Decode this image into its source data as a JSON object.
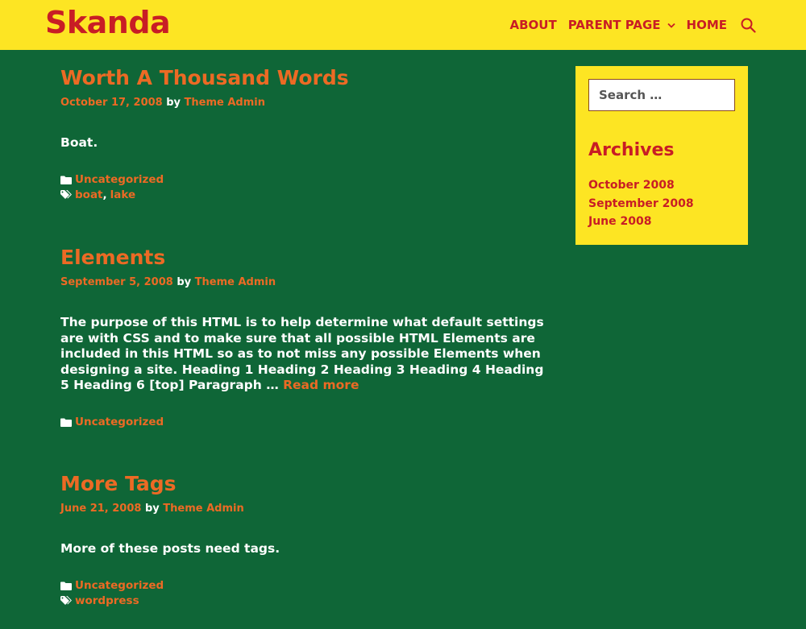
{
  "site": {
    "logo": "Skanda",
    "nav": {
      "about": "ABOUT",
      "parent_page": "PARENT PAGE",
      "home": "HOME"
    }
  },
  "posts": [
    {
      "title": "Worth A Thousand Words",
      "date": "October 17, 2008",
      "by": "by",
      "author": "Theme Admin",
      "excerpt": "Boat.",
      "category": "Uncategorized",
      "tags": [
        "boat",
        "lake"
      ],
      "tag_sep": ","
    },
    {
      "title": "Elements",
      "date": "September 5, 2008",
      "by": "by",
      "author": "Theme Admin",
      "excerpt": "The purpose of this HTML is to help determine what default settings are with CSS and to make sure that all possible HTML Elements are included in this HTML so as to not miss any possible Elements when designing a site. Heading 1 Heading 2 Heading 3 Heading 4 Heading 5 Heading 6 [top] Paragraph …",
      "read_more": "Read more",
      "category": "Uncategorized"
    },
    {
      "title": "More Tags",
      "date": "June 21, 2008",
      "by": "by",
      "author": "Theme Admin",
      "excerpt": "More of these posts need tags.",
      "category": "Uncategorized",
      "tags": [
        "wordpress"
      ]
    }
  ],
  "sidebar": {
    "search_placeholder": "Search …",
    "archives_title": "Archives",
    "archives": [
      "October 2008",
      "September 2008",
      "June 2008"
    ]
  },
  "colors": {
    "background": "#0f6637",
    "header": "#fde523",
    "brand_red": "#c81d25",
    "accent_orange": "#ec6a24",
    "text": "#ffffff"
  }
}
